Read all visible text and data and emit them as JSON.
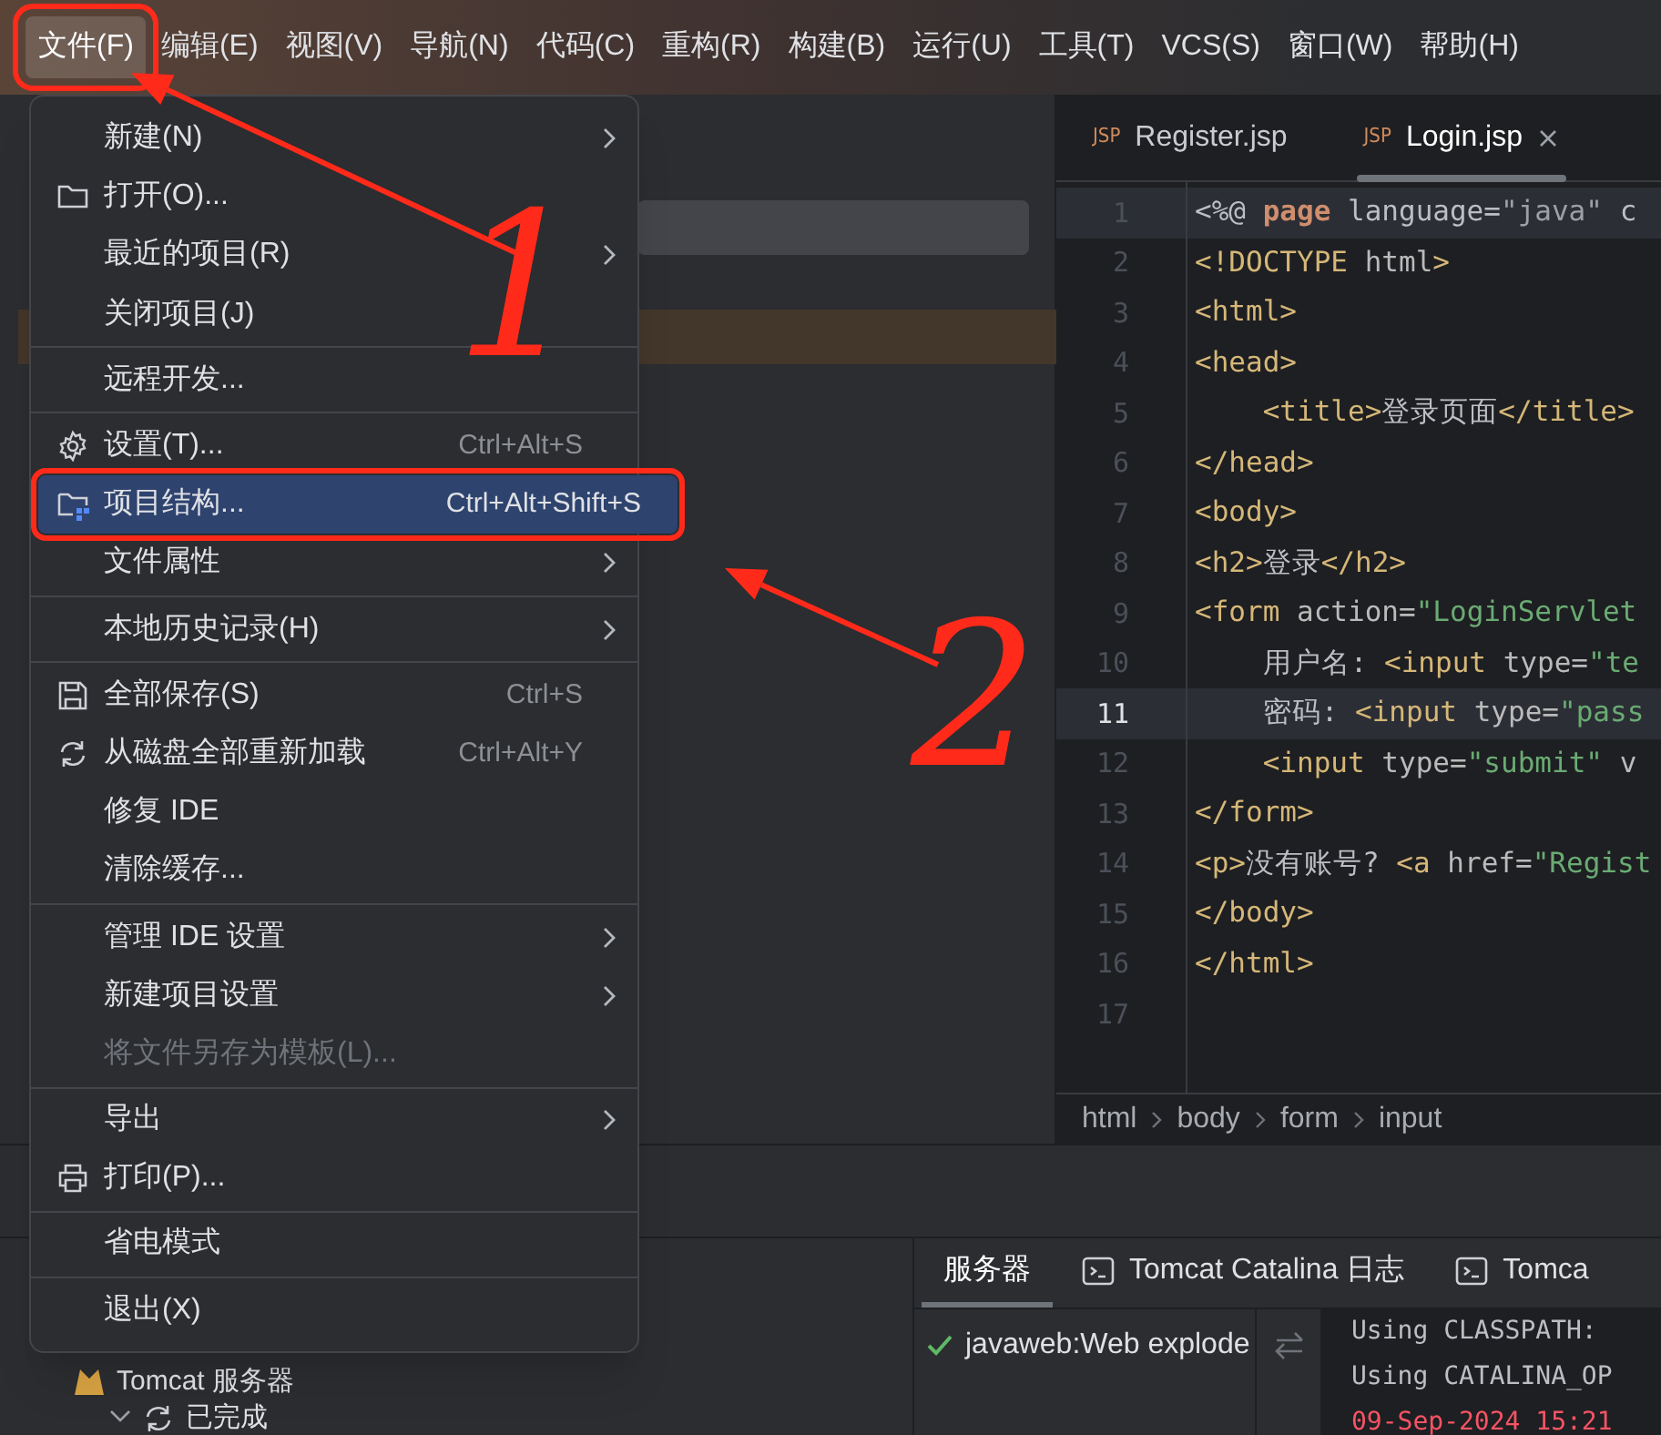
{
  "menu_bar": [
    {
      "label": "文件(F)",
      "selected": true,
      "annotated": true
    },
    {
      "label": "编辑(E)",
      "selected": false,
      "annotated": false
    },
    {
      "label": "视图(V)",
      "selected": false,
      "annotated": false
    },
    {
      "label": "导航(N)",
      "selected": false,
      "annotated": false
    },
    {
      "label": "代码(C)",
      "selected": false,
      "annotated": false
    },
    {
      "label": "重构(R)",
      "selected": false,
      "annotated": false
    },
    {
      "label": "构建(B)",
      "selected": false,
      "annotated": false
    },
    {
      "label": "运行(U)",
      "selected": false,
      "annotated": false
    },
    {
      "label": "工具(T)",
      "selected": false,
      "annotated": false
    },
    {
      "label": "VCS(S)",
      "selected": false,
      "annotated": false
    },
    {
      "label": "窗口(W)",
      "selected": false,
      "annotated": false
    },
    {
      "label": "帮助(H)",
      "selected": false,
      "annotated": false
    }
  ],
  "file_menu": {
    "sections": [
      [
        {
          "label": "新建(N)",
          "submenu": true,
          "selected": false,
          "disabled": false,
          "annotated": false
        },
        {
          "label": "打开(O)...",
          "submenu": false,
          "selected": false,
          "disabled": false,
          "annotated": false
        },
        {
          "label": "最近的项目(R)",
          "submenu": true,
          "selected": false,
          "disabled": false,
          "annotated": false
        },
        {
          "label": "关闭项目(J)",
          "submenu": false,
          "selected": false,
          "disabled": false,
          "annotated": false
        }
      ],
      [
        {
          "label": "远程开发...",
          "submenu": false,
          "selected": false,
          "disabled": false,
          "annotated": false
        }
      ],
      [
        {
          "label": "设置(T)...",
          "shortcut": "Ctrl+Alt+S",
          "submenu": false,
          "selected": false,
          "disabled": false,
          "annotated": false
        },
        {
          "label": "项目结构...",
          "shortcut": "Ctrl+Alt+Shift+S",
          "submenu": false,
          "selected": true,
          "disabled": false,
          "annotated": true
        },
        {
          "label": "文件属性",
          "submenu": true,
          "selected": false,
          "disabled": false,
          "annotated": false
        }
      ],
      [
        {
          "label": "本地历史记录(H)",
          "submenu": true,
          "selected": false,
          "disabled": false,
          "annotated": false
        }
      ],
      [
        {
          "label": "全部保存(S)",
          "shortcut": "Ctrl+S",
          "submenu": false,
          "selected": false,
          "disabled": false,
          "annotated": false
        },
        {
          "label": "从磁盘全部重新加载",
          "shortcut": "Ctrl+Alt+Y",
          "submenu": false,
          "selected": false,
          "disabled": false,
          "annotated": false
        },
        {
          "label": "修复 IDE",
          "submenu": false,
          "selected": false,
          "disabled": false,
          "annotated": false
        },
        {
          "label": "清除缓存...",
          "submenu": false,
          "selected": false,
          "disabled": false,
          "annotated": false
        }
      ],
      [
        {
          "label": "管理 IDE 设置",
          "submenu": true,
          "selected": false,
          "disabled": false,
          "annotated": false
        },
        {
          "label": "新建项目设置",
          "submenu": true,
          "selected": false,
          "disabled": false,
          "annotated": false
        },
        {
          "label": "将文件另存为模板(L)...",
          "submenu": false,
          "selected": false,
          "disabled": true,
          "annotated": false
        }
      ],
      [
        {
          "label": "导出",
          "submenu": true,
          "selected": false,
          "disabled": false,
          "annotated": false
        },
        {
          "label": "打印(P)...",
          "submenu": false,
          "selected": false,
          "disabled": false,
          "annotated": false
        }
      ],
      [
        {
          "label": "省电模式",
          "submenu": false,
          "selected": false,
          "disabled": false,
          "annotated": false
        }
      ],
      [
        {
          "label": "退出(X)",
          "submenu": false,
          "selected": false,
          "disabled": false,
          "annotated": false
        }
      ]
    ]
  },
  "editor": {
    "tabs": [
      {
        "label": "Register.jsp",
        "badge": "JSP",
        "selected": false
      },
      {
        "label": "Login.jsp",
        "badge": "JSP",
        "selected": true
      }
    ],
    "lines": [
      {
        "number": "1",
        "current": false,
        "highlighted": true,
        "tokens": [
          {
            "text": "<%@ ",
            "kind": "plain"
          },
          {
            "text": "page",
            "kind": "keyword"
          },
          {
            "text": " language=",
            "kind": "plain"
          },
          {
            "text": "\"java\"",
            "kind": "dvalue"
          },
          {
            "text": " c",
            "kind": "plain"
          }
        ]
      },
      {
        "number": "2",
        "current": false,
        "highlighted": false,
        "tokens": [
          {
            "text": "<!DOCTYPE",
            "kind": "tag"
          },
          {
            "text": " html",
            "kind": "attr"
          },
          {
            "text": ">",
            "kind": "tag"
          }
        ]
      },
      {
        "number": "3",
        "current": false,
        "highlighted": false,
        "tokens": [
          {
            "text": "<html>",
            "kind": "tag"
          }
        ]
      },
      {
        "number": "4",
        "current": false,
        "highlighted": false,
        "tokens": [
          {
            "text": "<head>",
            "kind": "tag"
          }
        ]
      },
      {
        "number": "5",
        "current": false,
        "highlighted": false,
        "tokens": [
          {
            "text": "    <title>",
            "kind": "tag"
          },
          {
            "text": "登录页面",
            "kind": "plain"
          },
          {
            "text": "</title>",
            "kind": "tag"
          }
        ]
      },
      {
        "number": "6",
        "current": false,
        "highlighted": false,
        "tokens": [
          {
            "text": "</head>",
            "kind": "tag"
          }
        ]
      },
      {
        "number": "7",
        "current": false,
        "highlighted": false,
        "tokens": [
          {
            "text": "<body>",
            "kind": "tag"
          }
        ]
      },
      {
        "number": "8",
        "current": false,
        "highlighted": false,
        "tokens": [
          {
            "text": "<h2>",
            "kind": "tag"
          },
          {
            "text": "登录",
            "kind": "plain"
          },
          {
            "text": "</h2>",
            "kind": "tag"
          }
        ]
      },
      {
        "number": "9",
        "current": false,
        "highlighted": false,
        "tokens": [
          {
            "text": "<form",
            "kind": "tag"
          },
          {
            "text": " action=",
            "kind": "attr"
          },
          {
            "text": "\"LoginServlet",
            "kind": "string"
          }
        ]
      },
      {
        "number": "10",
        "current": false,
        "highlighted": false,
        "tokens": [
          {
            "text": "    用户名: ",
            "kind": "plain"
          },
          {
            "text": "<input",
            "kind": "tag"
          },
          {
            "text": " type=",
            "kind": "attr"
          },
          {
            "text": "\"te",
            "kind": "string"
          }
        ]
      },
      {
        "number": "11",
        "current": true,
        "highlighted": true,
        "tokens": [
          {
            "text": "    密码: ",
            "kind": "plain"
          },
          {
            "text": "<input",
            "kind": "tag"
          },
          {
            "text": " type=",
            "kind": "attr"
          },
          {
            "text": "\"pass",
            "kind": "string"
          }
        ]
      },
      {
        "number": "12",
        "current": false,
        "highlighted": false,
        "tokens": [
          {
            "text": "    <input",
            "kind": "tag"
          },
          {
            "text": " type=",
            "kind": "attr"
          },
          {
            "text": "\"submit\"",
            "kind": "string"
          },
          {
            "text": " v",
            "kind": "attr"
          }
        ]
      },
      {
        "number": "13",
        "current": false,
        "highlighted": false,
        "tokens": [
          {
            "text": "</form>",
            "kind": "tag"
          }
        ]
      },
      {
        "number": "14",
        "current": false,
        "highlighted": false,
        "tokens": [
          {
            "text": "<p>",
            "kind": "tag"
          },
          {
            "text": "没有账号? ",
            "kind": "plain"
          },
          {
            "text": "<a",
            "kind": "tag"
          },
          {
            "text": " href=",
            "kind": "attr"
          },
          {
            "text": "\"Regist",
            "kind": "string"
          }
        ]
      },
      {
        "number": "15",
        "current": false,
        "highlighted": false,
        "tokens": [
          {
            "text": "</body>",
            "kind": "tag"
          }
        ]
      },
      {
        "number": "16",
        "current": false,
        "highlighted": false,
        "tokens": [
          {
            "text": "</html>",
            "kind": "tag"
          }
        ]
      },
      {
        "number": "17",
        "current": false,
        "highlighted": false
      }
    ],
    "breadcrumbs": [
      "html",
      "body",
      "form",
      "input"
    ]
  },
  "services": {
    "tree": [
      {
        "label": "Tomcat 服务器",
        "children": [
          {
            "label": "已完成",
            "expanded": true
          }
        ]
      }
    ],
    "tabs": [
      {
        "label": "服务器",
        "selected": true
      },
      {
        "label": "Tomcat Catalina 日志",
        "selected": false
      },
      {
        "label": "Tomca",
        "selected": false
      }
    ],
    "deployments": [
      {
        "label": "javaweb:Web explode",
        "succeeded": true
      }
    ],
    "console": [
      {
        "text": "Using CLASSPATH:",
        "kind": "info"
      },
      {
        "text": "Using CATALINA_OP",
        "kind": "info"
      },
      {
        "text": "09-Sep-2024 15:21",
        "kind": "error"
      }
    ]
  },
  "annotations": [
    {
      "kind": "arrow_number",
      "text": "1"
    },
    {
      "kind": "arrow_number",
      "text": "2"
    }
  ]
}
